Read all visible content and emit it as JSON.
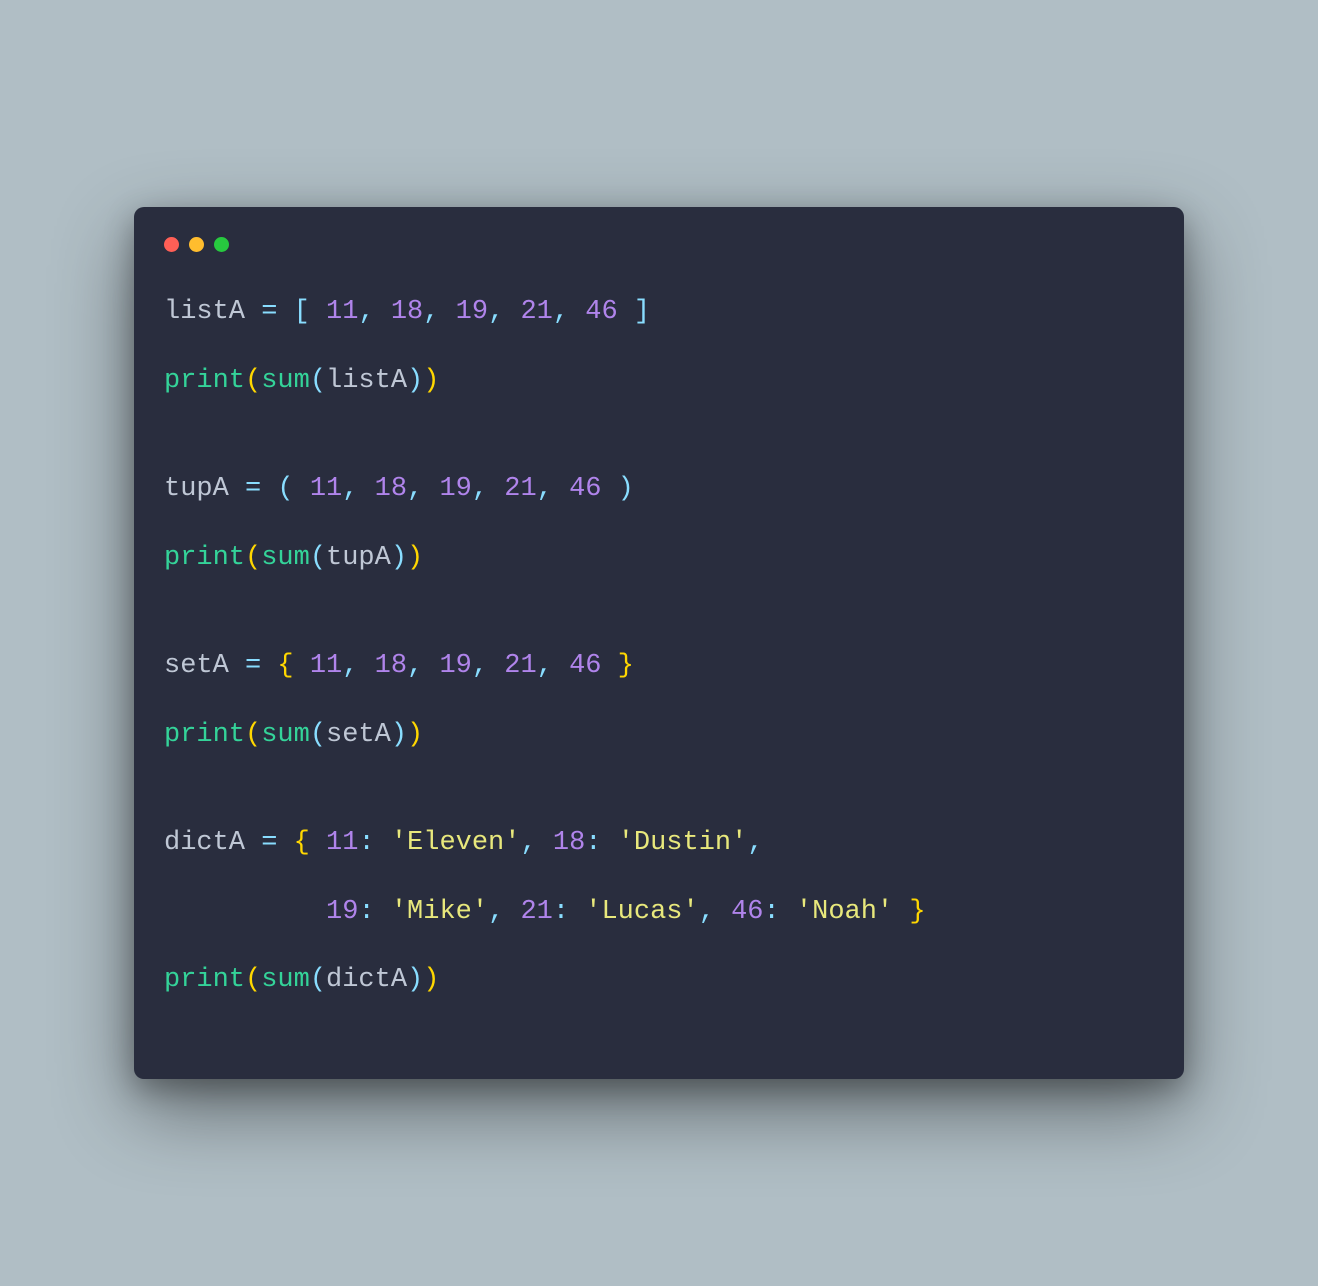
{
  "window": {
    "traffic_lights": {
      "red": "#ff5f56",
      "yellow": "#ffbd2e",
      "green": "#27c93f"
    }
  },
  "code": {
    "line1": {
      "var": "listA",
      "eq": " = ",
      "open": "[ ",
      "n1": "11",
      "c1": ", ",
      "n2": "18",
      "c2": ", ",
      "n3": "19",
      "c3": ", ",
      "n4": "21",
      "c4": ", ",
      "n5": "46",
      "close": " ]"
    },
    "line2": {
      "print": "print",
      "po": "(",
      "sum": "sum",
      "pi": "(",
      "arg": "listA",
      "pc": ")",
      "pc2": ")"
    },
    "line3": {
      "var": "tupA",
      "eq": " = ",
      "open": "( ",
      "n1": "11",
      "c1": ", ",
      "n2": "18",
      "c2": ", ",
      "n3": "19",
      "c3": ", ",
      "n4": "21",
      "c4": ", ",
      "n5": "46",
      "close": " )"
    },
    "line4": {
      "print": "print",
      "po": "(",
      "sum": "sum",
      "pi": "(",
      "arg": "tupA",
      "pc": ")",
      "pc2": ")"
    },
    "line5": {
      "var": "setA",
      "eq": " = ",
      "open": "{ ",
      "n1": "11",
      "c1": ", ",
      "n2": "18",
      "c2": ", ",
      "n3": "19",
      "c3": ", ",
      "n4": "21",
      "c4": ", ",
      "n5": "46",
      "close": " }"
    },
    "line6": {
      "print": "print",
      "po": "(",
      "sum": "sum",
      "pi": "(",
      "arg": "setA",
      "pc": ")",
      "pc2": ")"
    },
    "line7": {
      "var": "dictA",
      "eq": " = ",
      "open": "{ ",
      "k1": "11",
      "col1": ": ",
      "v1": "'Eleven'",
      "c1": ", ",
      "k2": "18",
      "col2": ": ",
      "v2": "'Dustin'",
      "c2": ","
    },
    "line8": {
      "indent": "          ",
      "k3": "19",
      "col3": ": ",
      "v3": "'Mike'",
      "c3": ", ",
      "k4": "21",
      "col4": ": ",
      "v4": "'Lucas'",
      "c4": ", ",
      "k5": "46",
      "col5": ": ",
      "v5": "'Noah'",
      "close": " }"
    },
    "line9": {
      "print": "print",
      "po": "(",
      "sum": "sum",
      "pi": "(",
      "arg": "dictA",
      "pc": ")",
      "pc2": ")"
    }
  }
}
